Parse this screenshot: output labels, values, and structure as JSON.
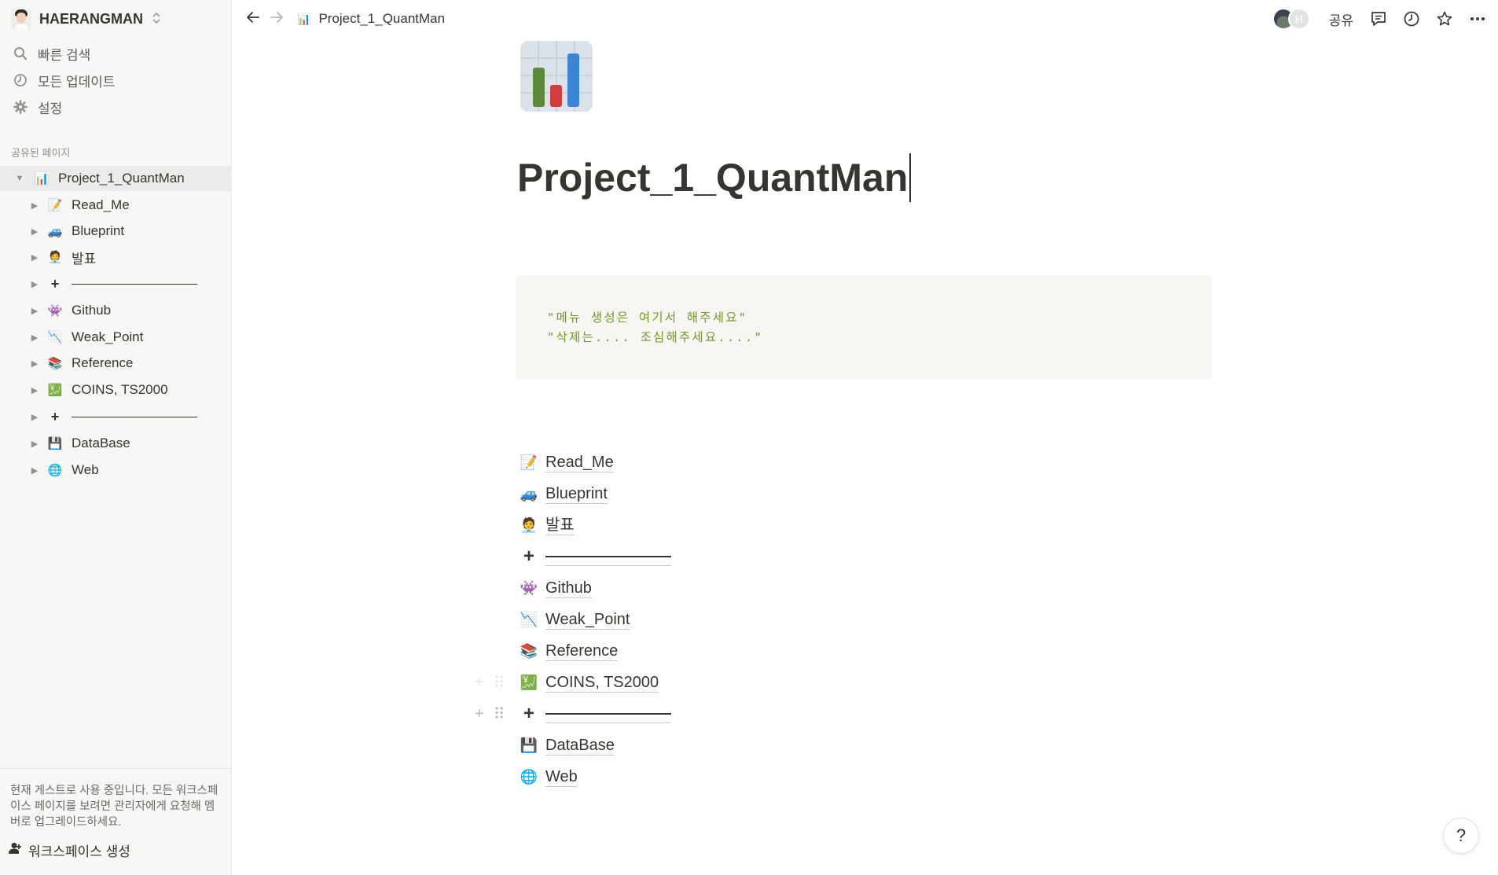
{
  "sidebar": {
    "workspace_name": "HAERANGMAN",
    "workspace_chevron": "⌃⌄",
    "nav": [
      {
        "label": "빠른 검색",
        "icon": "search-icon"
      },
      {
        "label": "모든 업데이트",
        "icon": "clock-icon"
      },
      {
        "label": "설정",
        "icon": "gear-icon"
      }
    ],
    "shared_label": "공유된 페이지",
    "root_page": {
      "label": "Project_1_QuantMan",
      "emoji": "📊"
    },
    "children": [
      {
        "label": "Read_Me",
        "emoji": "📝"
      },
      {
        "label": "Blueprint",
        "emoji": "🚙"
      },
      {
        "label": "발표",
        "emoji": "🧑‍💼"
      },
      {
        "label": "",
        "emoji": "➕",
        "divider": true
      },
      {
        "label": "Github",
        "emoji": "👾"
      },
      {
        "label": "Weak_Point",
        "emoji": "📉"
      },
      {
        "label": "Reference",
        "emoji": "📚"
      },
      {
        "label": "COINS, TS2000",
        "emoji": "💹"
      },
      {
        "label": "",
        "emoji": "➕",
        "divider": true
      },
      {
        "label": "DataBase",
        "emoji": "💾"
      },
      {
        "label": "Web",
        "emoji": "🌐"
      }
    ],
    "guest_note": "현재 게스트로 사용 중입니다. 모든 워크스페이스 페이지를 보려면 관리자에게 요청해 멤버로 업그레이드하세요.",
    "create_workspace_label": "워크스페이스 생성"
  },
  "topbar": {
    "breadcrumb": "Project_1_QuantMan",
    "breadcrumb_emoji": "📊",
    "avatar_letter": "H",
    "share_label": "공유"
  },
  "page": {
    "title": "Project_1_QuantMan",
    "icon": "bar-chart-icon",
    "code_lines": [
      "\"메뉴 생성은 여기서 해주세요\"",
      "\"삭제는.... 조심해주세요....\""
    ],
    "links": [
      {
        "label": "Read_Me",
        "emoji": "📝"
      },
      {
        "label": "Blueprint",
        "emoji": "🚙"
      },
      {
        "label": "발표",
        "emoji": "🧑‍💼"
      },
      {
        "label": "",
        "emoji": "➕",
        "divider": true
      },
      {
        "label": "Github",
        "emoji": "👾"
      },
      {
        "label": "Weak_Point",
        "emoji": "📉"
      },
      {
        "label": "Reference",
        "emoji": "📚"
      },
      {
        "label": "COINS, TS2000",
        "emoji": "💹"
      },
      {
        "label": "",
        "emoji": "➕",
        "divider": true
      },
      {
        "label": "DataBase",
        "emoji": "💾"
      },
      {
        "label": "Web",
        "emoji": "🌐"
      }
    ]
  },
  "help_label": "?",
  "colors": {
    "sidebar_bg": "#f7f7f5",
    "text": "#37352f",
    "code_text": "#6f9b23",
    "code_bg": "#f7f6f3",
    "bar_green": "#5c8a3a",
    "bar_red": "#d23c3c",
    "bar_blue": "#3a86d6"
  }
}
